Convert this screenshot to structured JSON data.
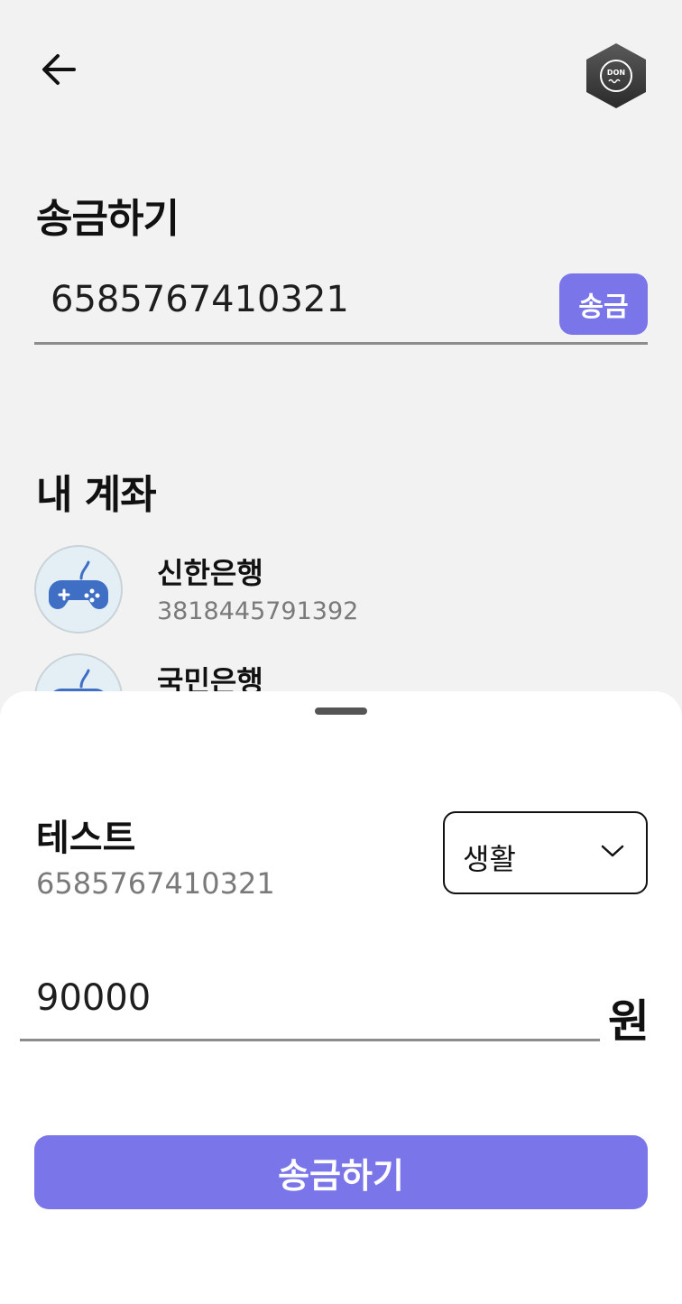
{
  "header": {
    "back_icon": "arrow-left-icon",
    "logo_text": "DON"
  },
  "transfer": {
    "title": "송금하기",
    "account_value": "6585767410321",
    "send_label": "송금"
  },
  "my_accounts": {
    "title": "내 계좌",
    "items": [
      {
        "bank": "신한은행",
        "number": "3818445791392",
        "icon": "gamepad-icon"
      },
      {
        "bank": "국민은행",
        "number": "",
        "icon": "gamepad-icon"
      }
    ]
  },
  "sheet": {
    "recipient_name": "테스트",
    "recipient_number": "6585767410321",
    "category": "생활",
    "amount": "90000",
    "currency": "원",
    "submit_label": "송금하기"
  },
  "colors": {
    "accent": "#7a76ea",
    "background": "#f2f2f2",
    "avatar_bg": "#e3eef5",
    "gamepad": "#3f6fc4"
  }
}
